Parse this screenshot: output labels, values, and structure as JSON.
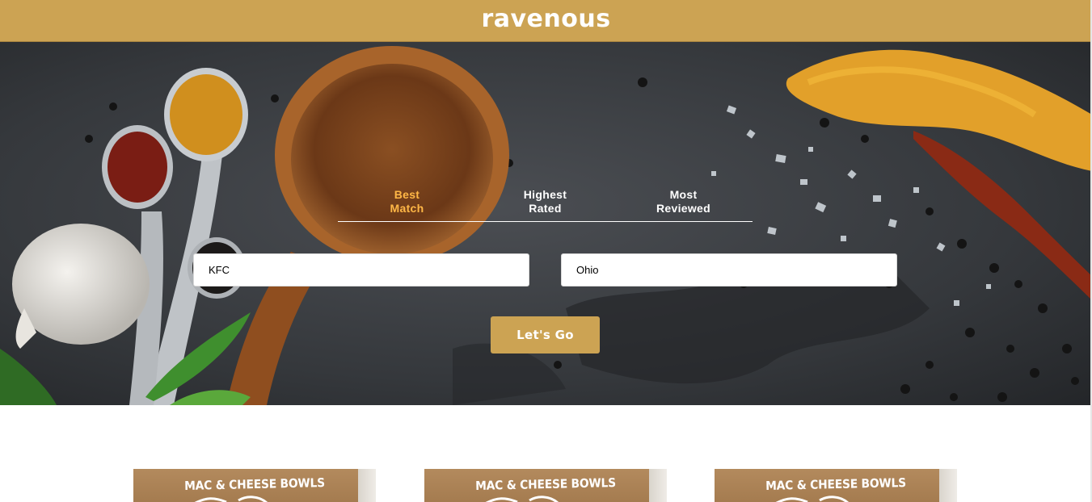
{
  "app": {
    "logo": "ravenous"
  },
  "sort_options": [
    {
      "line1": "Best",
      "line2": "Match",
      "active": true
    },
    {
      "line1": "Highest",
      "line2": "Rated",
      "active": false
    },
    {
      "line1": "Most",
      "line2": "Reviewed",
      "active": false
    }
  ],
  "search": {
    "term_value": "KFC",
    "location_value": "Ohio",
    "submit_label": "Let's Go"
  },
  "businesses": [
    {
      "image_text": "MAC & CHEESE BOWLS"
    },
    {
      "image_text": "MAC & CHEESE BOWLS"
    },
    {
      "image_text": "MAC & CHEESE BOWLS"
    }
  ],
  "colors": {
    "brand": "#cca353",
    "active_sort": "#ffb746",
    "hero_dark": "#2e3034"
  }
}
